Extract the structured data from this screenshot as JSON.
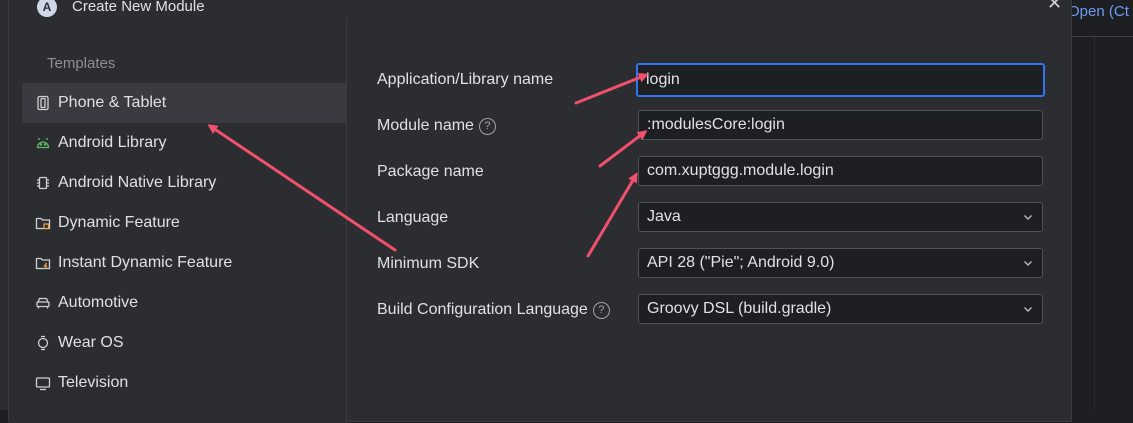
{
  "background": {
    "peek_text": "Open (Ct"
  },
  "dialog": {
    "title": "Create New Module",
    "logo_glyph": "A",
    "close_glyph": "✕"
  },
  "templates": {
    "heading": "Templates",
    "items": [
      {
        "label": "Phone & Tablet",
        "icon": "phone-tablet-icon",
        "selected": true
      },
      {
        "label": "Android Library",
        "icon": "android-icon",
        "selected": false
      },
      {
        "label": "Android Native Library",
        "icon": "chip-icon",
        "selected": false
      },
      {
        "label": "Dynamic Feature",
        "icon": "folder-icon",
        "selected": false
      },
      {
        "label": "Instant Dynamic Feature",
        "icon": "folder-lightning-icon",
        "selected": false
      },
      {
        "label": "Automotive",
        "icon": "car-icon",
        "selected": false
      },
      {
        "label": "Wear OS",
        "icon": "watch-icon",
        "selected": false
      },
      {
        "label": "Television",
        "icon": "tv-icon",
        "selected": false
      }
    ]
  },
  "form": {
    "app_name_label": "Application/Library name",
    "app_name_value": "login",
    "module_name_label": "Module name",
    "module_name_value": ":modulesCore:login",
    "package_name_label": "Package name",
    "package_name_value": "com.xuptggg.module.login",
    "language_label": "Language",
    "language_value": "Java",
    "min_sdk_label": "Minimum SDK",
    "min_sdk_value": "API 28 (\"Pie\"; Android 9.0)",
    "build_lang_label": "Build Configuration Language",
    "build_lang_value": "Groovy DSL (build.gradle)",
    "help_glyph": "?"
  },
  "colors": {
    "accent": "#3574f0",
    "annotation_arrow": "#f0506e",
    "dialog_bg": "#2b2d30",
    "input_bg": "#1e1f22"
  }
}
